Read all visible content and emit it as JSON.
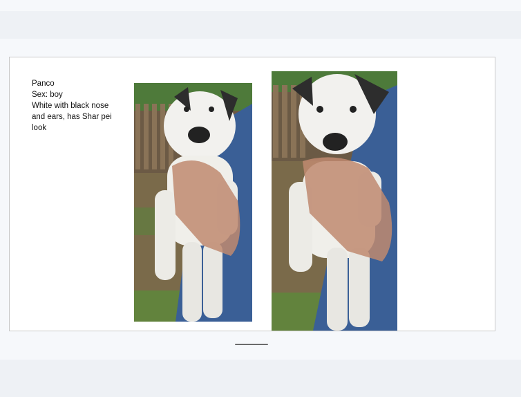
{
  "slide": {
    "caption": {
      "name": "Panco",
      "sex": "Sex: boy",
      "description": "White with black nose and ears, has Shar pei look"
    },
    "photos": [
      {
        "subject": "white puppy with black ears held in hands"
      },
      {
        "subject": "white puppy with black ears held in hands, closer view"
      }
    ]
  },
  "colors": {
    "page_bg": "#f6f8fb",
    "band": "#eef1f5",
    "slide_bg": "#ffffff",
    "slide_border": "#c8c8c8"
  }
}
